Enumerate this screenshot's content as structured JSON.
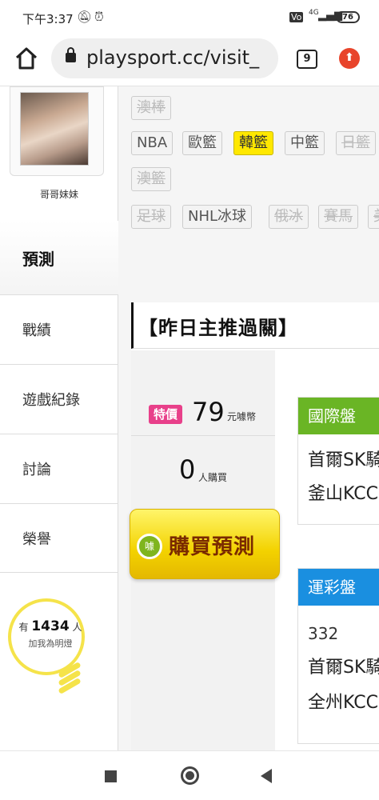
{
  "status_bar": {
    "time": "下午3:37",
    "battery": "76",
    "network": "4G"
  },
  "browser": {
    "url": "playsport.cc/visit_",
    "tab_count": "9"
  },
  "sidebar": {
    "profile_name": "哥哥妹妹",
    "active_item": "預測",
    "items": [
      {
        "label": "戰績"
      },
      {
        "label": "遊戲紀錄"
      },
      {
        "label": "討論"
      },
      {
        "label": "榮譽"
      }
    ],
    "fans_prefix": "有",
    "fans_count": "1434",
    "fans_suffix": "人",
    "fans_cta": "加我為明燈"
  },
  "categories": [
    {
      "label": "澳棒",
      "state": "disabled"
    },
    {
      "label": "NBA",
      "state": "normal"
    },
    {
      "label": "歐籃",
      "state": "normal"
    },
    {
      "label": "韓籃",
      "state": "active"
    },
    {
      "label": "中籃",
      "state": "normal"
    },
    {
      "label": "日籃",
      "state": "disabled"
    },
    {
      "label": "澳籃",
      "state": "disabled"
    },
    {
      "label": "足球",
      "state": "disabled"
    },
    {
      "label": "NHL冰球",
      "state": "normal"
    },
    {
      "label": "俄冰",
      "state": "disabled"
    },
    {
      "label": "賽馬",
      "state": "disabled"
    },
    {
      "label": "美",
      "state": "disabled"
    }
  ],
  "panel": {
    "title": "【昨日主推過關】",
    "badge": "特價",
    "price": "79",
    "currency": "元噱幣",
    "buyers": "0",
    "buyers_label": "人購買",
    "buy_button": "購買預測",
    "buy_icon": "噱"
  },
  "cards": [
    {
      "header": "國際盤",
      "color": "#6ab525",
      "lines": [
        "首爾SK騎",
        "釜山KCC"
      ]
    },
    {
      "header": "運彩盤",
      "color": "#1a8fe0",
      "lines": [
        "332",
        "首爾SK騎",
        "全州KCC"
      ]
    }
  ]
}
